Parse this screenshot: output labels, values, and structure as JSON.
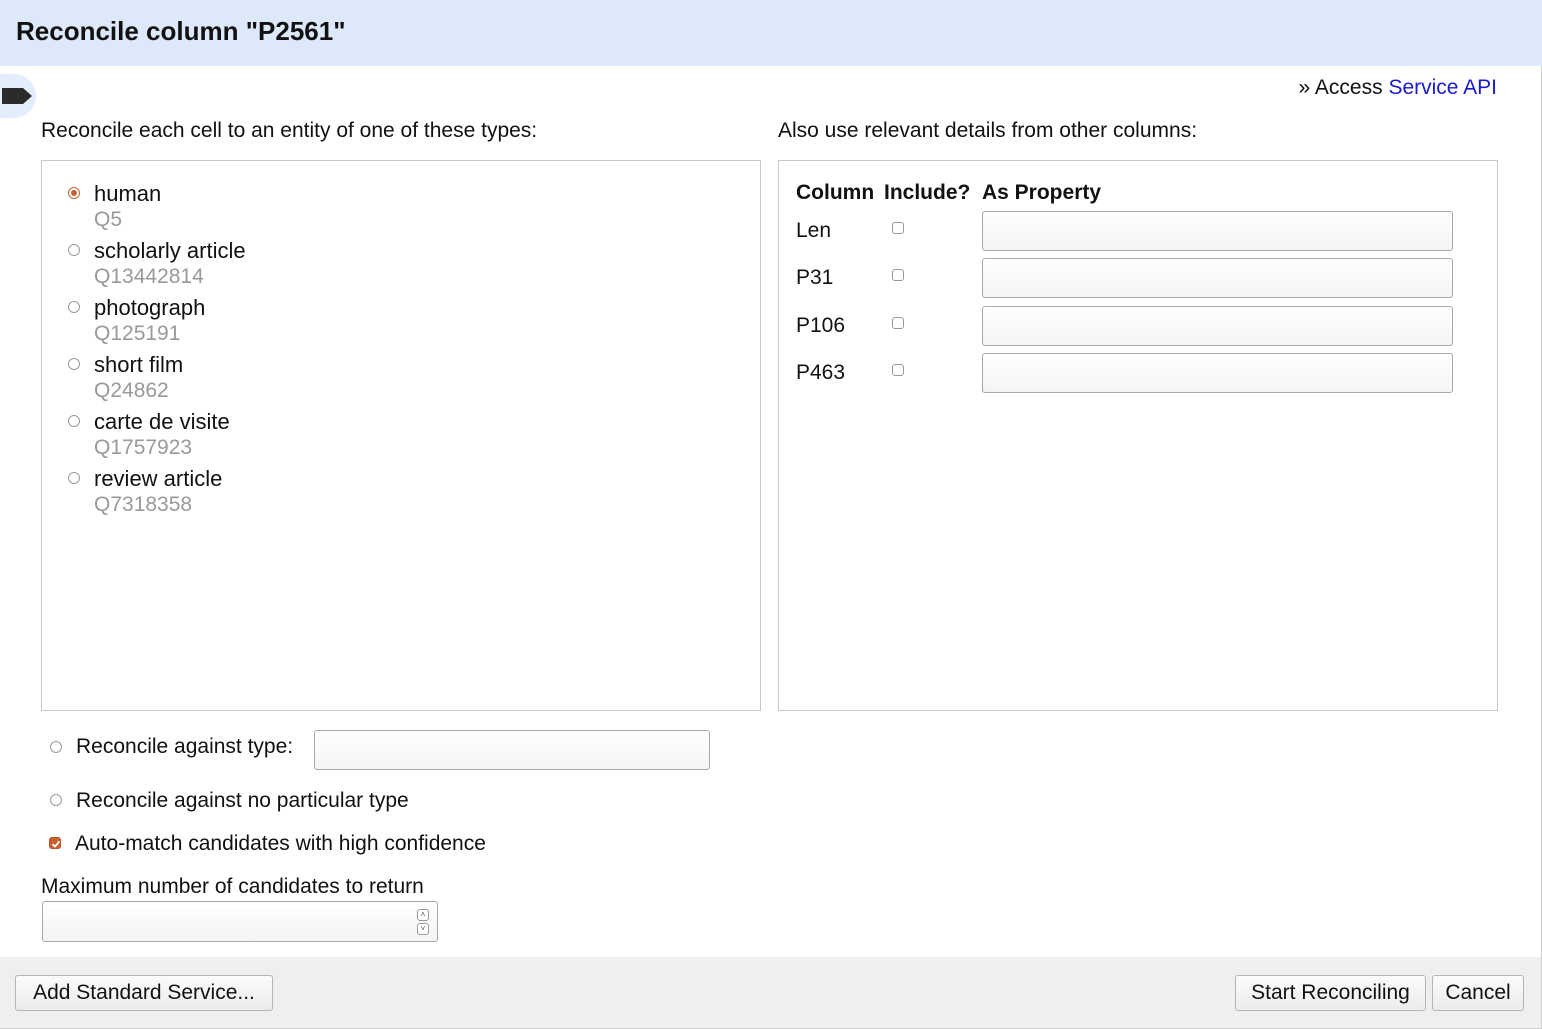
{
  "dialog": {
    "title": "Reconcile column \"P2561\"",
    "access_prefix": "» Access ",
    "access_link": "Service API",
    "left_label": "Reconcile each cell to an entity of one of these types:",
    "right_label": "Also use relevant details from other columns:"
  },
  "types": [
    {
      "name": "human",
      "id": "Q5",
      "selected": true
    },
    {
      "name": "scholarly article",
      "id": "Q13442814",
      "selected": false
    },
    {
      "name": "photograph",
      "id": "Q125191",
      "selected": false
    },
    {
      "name": "short film",
      "id": "Q24862",
      "selected": false
    },
    {
      "name": "carte de visite",
      "id": "Q1757923",
      "selected": false
    },
    {
      "name": "review article",
      "id": "Q7318358",
      "selected": false
    }
  ],
  "columns_table": {
    "headers": [
      "Column",
      "Include?",
      "As Property"
    ],
    "rows": [
      {
        "column": "Len",
        "include": false,
        "property": ""
      },
      {
        "column": "P31",
        "include": false,
        "property": ""
      },
      {
        "column": "P106",
        "include": false,
        "property": ""
      },
      {
        "column": "P463",
        "include": false,
        "property": ""
      }
    ]
  },
  "options": {
    "against_type_label": "Reconcile against type:",
    "against_type_value": "",
    "no_type_label": "Reconcile against no particular type",
    "automatch_label": "Auto-match candidates with high confidence",
    "automatch_checked": true,
    "max_candidates_label": "Maximum number of candidates to return",
    "max_candidates_value": ""
  },
  "footer": {
    "add_service_label": "Add Standard Service...",
    "start_label": "Start Reconciling",
    "cancel_label": "Cancel"
  },
  "colors": {
    "header_bg": "#dde9fb",
    "accent": "#c8612f",
    "link": "#1a1ad0",
    "footer_bg": "#efefef"
  }
}
